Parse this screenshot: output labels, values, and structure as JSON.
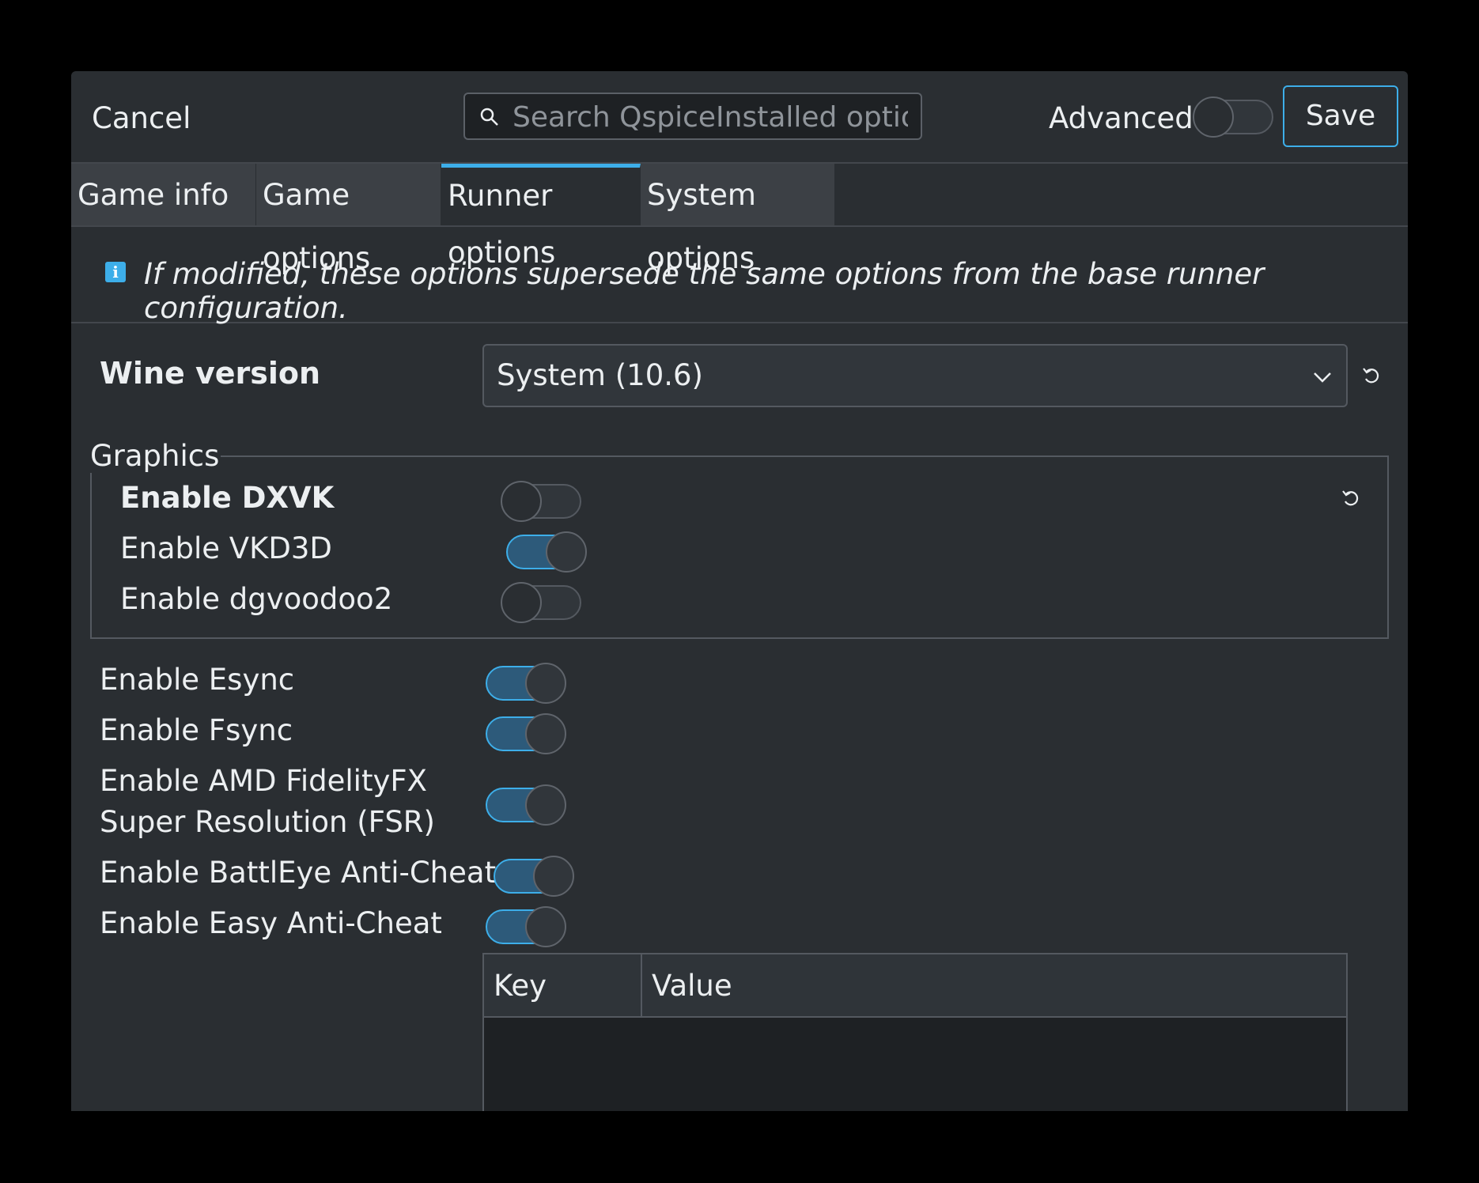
{
  "header": {
    "cancel_label": "Cancel",
    "search_placeholder": "Search QspiceInstalled options",
    "advanced_label": "Advanced",
    "advanced_on": false,
    "save_label": "Save"
  },
  "tabs": [
    {
      "label": "Game info",
      "active": false
    },
    {
      "label": "Game options",
      "active": false
    },
    {
      "label": "Runner options",
      "active": true
    },
    {
      "label": "System options",
      "active": false
    }
  ],
  "info_text": "If modified, these options supersede the same options from the base runner configuration.",
  "wine": {
    "label": "Wine version",
    "value": "System (10.6)"
  },
  "graphics": {
    "title": "Graphics",
    "options": [
      {
        "label": "Enable DXVK",
        "on": false
      },
      {
        "label": "Enable VKD3D",
        "on": true
      },
      {
        "label": "Enable dgvoodoo2",
        "on": false
      }
    ]
  },
  "options": [
    {
      "label": "Enable Esync",
      "on": true
    },
    {
      "label": "Enable Fsync",
      "on": true
    },
    {
      "label_line1": "Enable AMD FidelityFX",
      "label_line2": "Super Resolution (FSR)",
      "on": true
    },
    {
      "label": "Enable BattlEye Anti-Cheat",
      "on": true
    },
    {
      "label": "Enable Easy Anti-Cheat",
      "on": true
    }
  ],
  "env_table": {
    "key_header": "Key",
    "value_header": "Value"
  },
  "colors": {
    "accent": "#3daee9",
    "background": "#2a2e32",
    "toggle_on": "#2d5a7a"
  }
}
